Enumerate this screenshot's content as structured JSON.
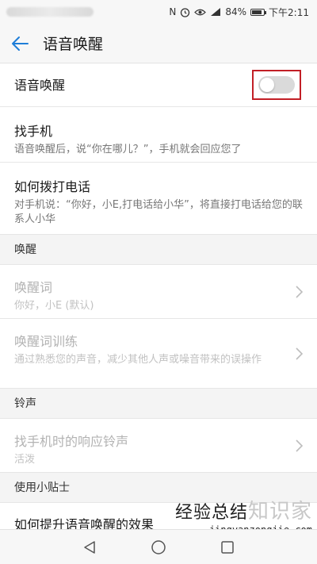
{
  "status_bar": {
    "battery": "84%",
    "battery_level": 0.84,
    "time": "下午2:11",
    "nfc_icon": "N"
  },
  "app_bar": {
    "title": "语音唤醒"
  },
  "rows": {
    "voice_wake": {
      "label": "语音唤醒",
      "toggle_on": false
    },
    "find_phone": {
      "label": "找手机",
      "desc": "语音唤醒后，说“你在哪儿？”，手机就会回应您了"
    },
    "call_howto": {
      "label": "如何拨打电话",
      "desc": "对手机说：“你好，小E,打电话给小华”，将直接打电话给您的联系人小华"
    }
  },
  "sections": {
    "wake": {
      "title": "唤醒",
      "items": [
        {
          "label": "唤醒词",
          "desc": "你好，小E (默认)"
        },
        {
          "label": "唤醒词训练",
          "desc": "通过熟悉您的声音，减少其他人声或噪音带来的误操作"
        }
      ]
    },
    "ringtone": {
      "title": "铃声",
      "items": [
        {
          "label": "找手机时的响应铃声",
          "desc": "活泼"
        }
      ]
    },
    "tips": {
      "title": "使用小贴士",
      "items": [
        {
          "label": "如何提升语音唤醒的效果"
        }
      ]
    }
  },
  "watermark": {
    "text": "经验总结",
    "ghost": "知识家",
    "url": "jingyanzongjie.com"
  },
  "colors": {
    "accent_blue": "#1f7ed8",
    "highlight_red": "#c21f26",
    "toggle_off": "#dadada"
  }
}
